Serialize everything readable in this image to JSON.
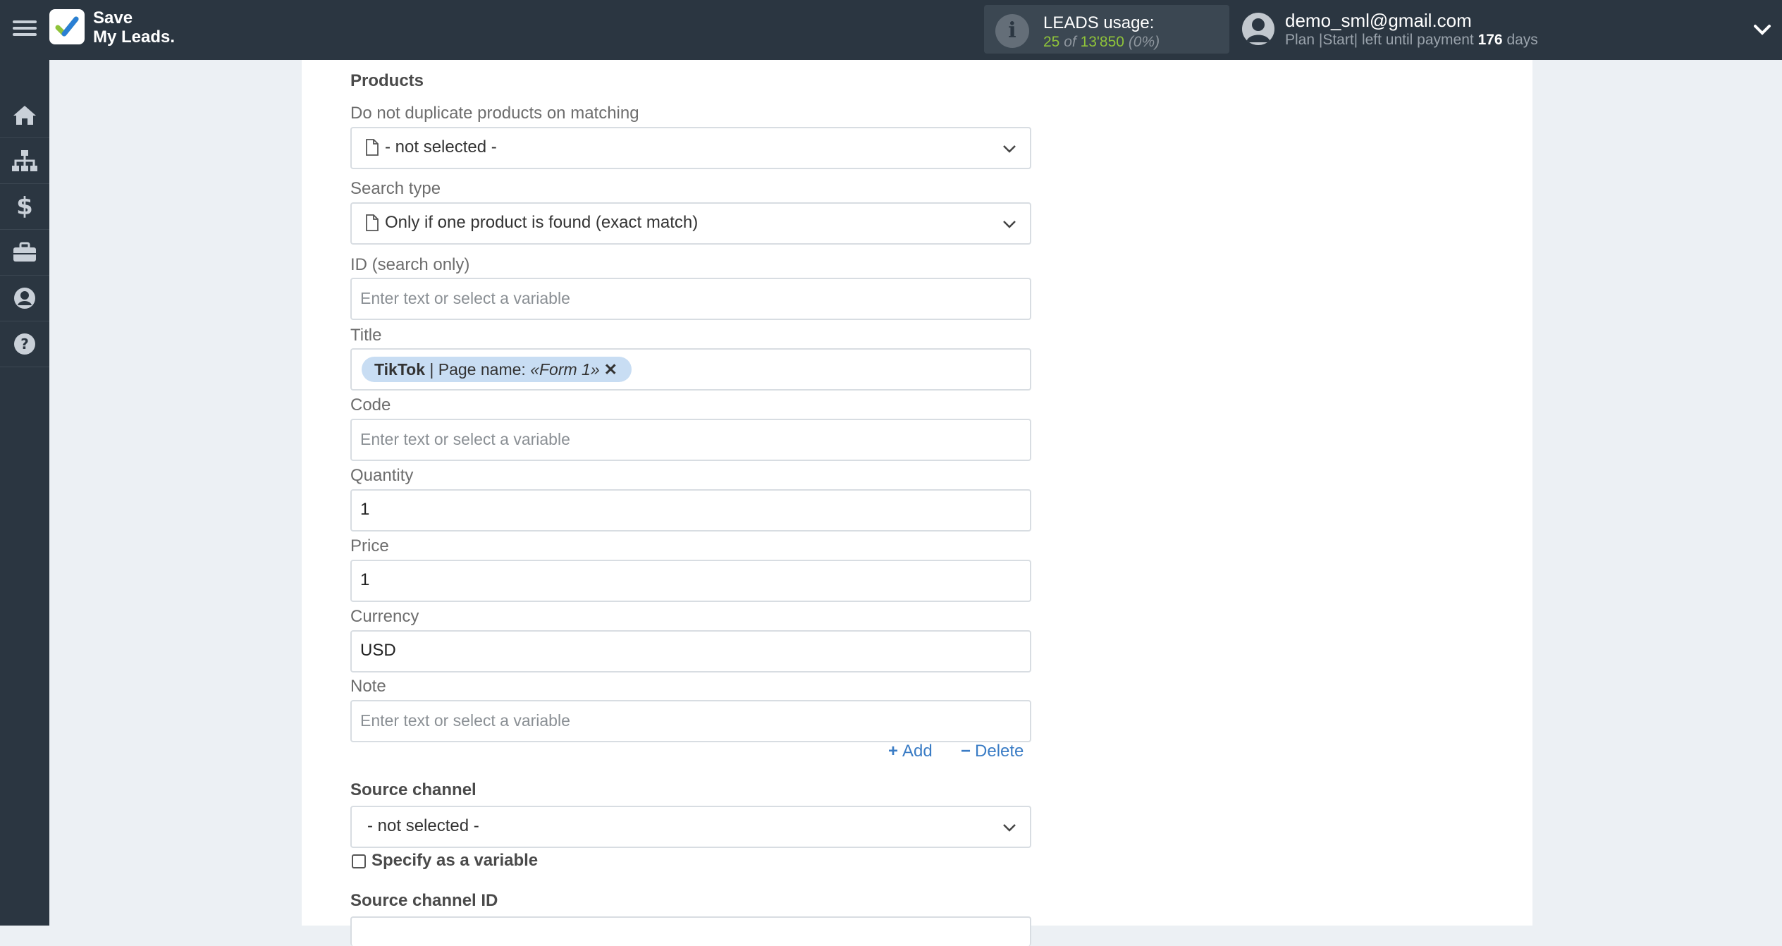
{
  "header": {
    "logo_line1": "Save",
    "logo_line2": "My Leads.",
    "usage_title": "LEADS usage:",
    "usage_used": "25",
    "usage_of": "of",
    "usage_total": "13'850",
    "usage_percent": "(0%)",
    "user_email": "demo_sml@gmail.com",
    "plan_prefix": "Plan |Start| left until payment",
    "plan_days": "176",
    "plan_suffix": "days"
  },
  "sidebar": {
    "items": [
      {
        "icon": "home-icon"
      },
      {
        "icon": "sitemap-icon"
      },
      {
        "icon": "dollar-icon"
      },
      {
        "icon": "briefcase-icon"
      },
      {
        "icon": "user-icon"
      },
      {
        "icon": "help-icon"
      }
    ]
  },
  "form": {
    "products_title": "Products",
    "no_dup_label": "Do not duplicate products on matching",
    "no_dup_value": "- not selected -",
    "search_type_label": "Search type",
    "search_type_value": "Only if one product is found (exact match)",
    "id_label": "ID (search only)",
    "placeholder": "Enter text or select a variable",
    "title_label": "Title",
    "title_tag_source": "TikTok",
    "title_tag_sep": " | Page name: ",
    "title_tag_value": "«Form 1»",
    "title_tag_remove": "✕",
    "code_label": "Code",
    "quantity_label": "Quantity",
    "quantity_value": "1",
    "price_label": "Price",
    "price_value": "1",
    "currency_label": "Currency",
    "currency_value": "USD",
    "note_label": "Note",
    "add_label": "Add",
    "delete_label": "Delete",
    "source_channel_title": "Source channel",
    "source_channel_value": "- not selected -",
    "specify_variable_label": "Specify as a variable",
    "source_channel_id_title": "Source channel ID"
  },
  "colors": {
    "topbar": "#2b3641",
    "accent_green": "#8fc33a",
    "link_blue": "#3a7cc5",
    "tag_bg": "#c8ddf3"
  }
}
